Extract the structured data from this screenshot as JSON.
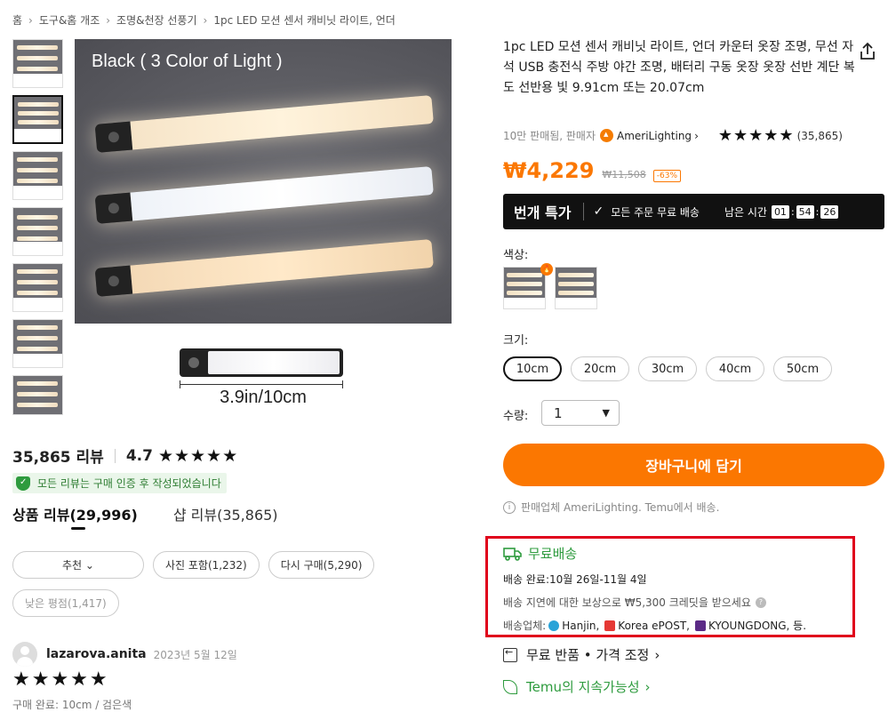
{
  "breadcrumb": {
    "items": [
      "홈",
      "도구&홈 개조",
      "조명&천장 선풍기",
      "1pc LED 모션 센서 캐비닛 라이트, 언더"
    ],
    "separator": "›"
  },
  "gallery": {
    "main_caption": "Black ( 3 Color of Light )",
    "dimension": "3.9in/10cm",
    "thumbnail_count": 7,
    "active_thumbnail": 2
  },
  "product": {
    "title": "1pc LED 모션 센서 캐비닛 라이트, 언더 카운터 옷장 조명, 무선 자석 USB 충전식 주방 야간 조명, 배터리 구동 옷장 옷장 선반 계단 복도 선반용 빛 9.91cm 또는 20.07cm",
    "sold": "10만 판매됨, 판매자",
    "store": "AmeriLighting",
    "store_chevron": "›",
    "rating_stars": "★★★★★",
    "rating_count": "(35,865)",
    "price": "₩4,229",
    "original_price": "₩11,508",
    "discount": "-63%"
  },
  "flash": {
    "label": "번개 특가",
    "check": "✓",
    "shipping": "모든 주문 무료 배송",
    "remaining_label": "남은 시간",
    "hours": "01",
    "minutes": "54",
    "seconds": "26",
    "colon": ":"
  },
  "options": {
    "color_label": "색상:",
    "size_label": "크기:",
    "sizes": [
      "10cm",
      "20cm",
      "30cm",
      "40cm",
      "50cm"
    ],
    "selected_size": "10cm",
    "qty_label": "수량:",
    "qty_value": "1",
    "hot_badge": "🔥"
  },
  "cart": {
    "button": "장바구니에 담기",
    "seller_note": "판매업체 AmeriLighting. Temu에서 배송.",
    "info": "i"
  },
  "shipping": {
    "title": "무료배송",
    "delivery": "배송 완료:10월 26일-11월 4일",
    "credit": "배송 지연에 대한 보상으로 ₩5,300 크레딧을 받으세요",
    "q": "?",
    "carrier_label": "배송업체:",
    "carrier1": "Hanjin,",
    "carrier2": "Korea ePOST,",
    "carrier3": "KYOUNGDONG, 등."
  },
  "links": {
    "returns": "무료 반품 • 가격 조정",
    "sustainability": "Temu의 지속가능성",
    "chevron": "›"
  },
  "reviews": {
    "count": "35,865 리뷰",
    "rating": "4.7",
    "stars": "★★★★★",
    "verified": "모든 리뷰는 구매 인증 후 작성되었습니다",
    "tab_product": "상품 리뷰(29,996)",
    "tab_shop": "샵 리뷰(35,865)",
    "filter_recommend": "추천",
    "filter_chevron": "⌄",
    "filter_photos": "사진 포함(1,232)",
    "filter_repurchase": "다시 구매(5,290)",
    "filter_low": "낮은 평점(1,417)",
    "reviewer_name": "lazarova.anita",
    "review_date": "2023년 5월 12일",
    "review_stars": "★★★★★",
    "purchase_info": "구매 완료: 10cm / 검은색"
  },
  "colors": {
    "accent": "#fb7701",
    "green": "#2e9b3e",
    "highlight_box": "#e0001b"
  }
}
